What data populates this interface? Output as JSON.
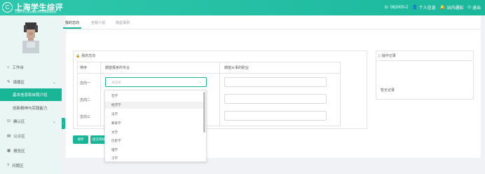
{
  "header": {
    "logo_mark": "C",
    "title": "上海学生综评",
    "subtitle": "上海市学生综合素质评价信息管理系统",
    "actions": [
      {
        "icon": "phone-icon",
        "label": "062000-2"
      },
      {
        "icon": "user-icon",
        "label": "个人信息"
      },
      {
        "icon": "bell-icon",
        "label": "站内通知"
      },
      {
        "icon": "logout-icon",
        "label": "退出"
      }
    ]
  },
  "sidebar": {
    "items": [
      {
        "icon": "home-icon",
        "label": "工作台"
      },
      {
        "icon": "edit-icon",
        "label": "填报区",
        "chevron": "⌄"
      },
      {
        "label": "基本信息和自我介绍",
        "active": true
      },
      {
        "label": "创新精神与实践能力"
      },
      {
        "icon": "check-icon",
        "label": "确认区",
        "chevron": "⌄"
      },
      {
        "icon": "public-icon",
        "label": "公示区"
      },
      {
        "icon": "report-icon",
        "label": "报告区"
      },
      {
        "icon": "question-icon",
        "label": "问题区"
      }
    ]
  },
  "tabs": [
    {
      "label": "我的志向",
      "active": true
    },
    {
      "label": "自我介绍"
    },
    {
      "label": "典型事例"
    }
  ],
  "main_panel": {
    "title": "我的志向",
    "columns": [
      "排序",
      "期望报考的专业",
      "期望从事的职业"
    ],
    "rows": [
      {
        "order": "志向一",
        "major_placeholder": "请选择"
      },
      {
        "order": "志向二"
      },
      {
        "order": "志向三"
      }
    ]
  },
  "side_panel": {
    "title": "操作记录",
    "empty_text": "暂无记录"
  },
  "dropdown": {
    "options": [
      "哲学",
      "经济学",
      "法学",
      "教育学",
      "文学",
      "历史学",
      "理学",
      "工学"
    ],
    "highlighted_index": 1
  },
  "buttons": {
    "save": "保存",
    "submit": "提交审核"
  },
  "colors": {
    "accent": "#18b597",
    "topbar": "#2fc7ad",
    "sidebar_bg": "#e9f6f3"
  }
}
